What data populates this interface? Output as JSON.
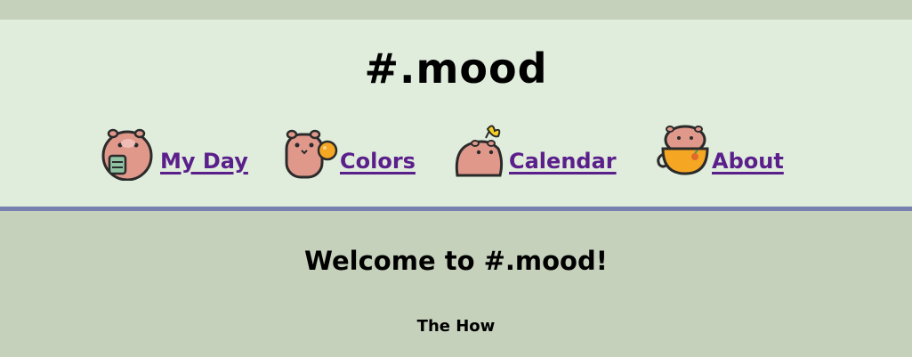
{
  "header": {
    "title": "#.mood"
  },
  "nav": {
    "items": [
      {
        "label": "My Day",
        "icon": "capybara-holding-cup-icon"
      },
      {
        "label": "Colors",
        "icon": "capybara-with-orange-icon"
      },
      {
        "label": "Calendar",
        "icon": "capybara-with-butterfly-icon"
      },
      {
        "label": "About",
        "icon": "capybara-in-orange-mug-icon"
      }
    ]
  },
  "main": {
    "heading": "Welcome to #.mood!",
    "subheading": "The How"
  },
  "colors": {
    "page_background": "#c6d1bc",
    "header_background": "#e0eddc",
    "header_border": "#7880b0",
    "link": "#5b1f8c",
    "capybara": "#e0988a",
    "orange": "#f5a623"
  }
}
